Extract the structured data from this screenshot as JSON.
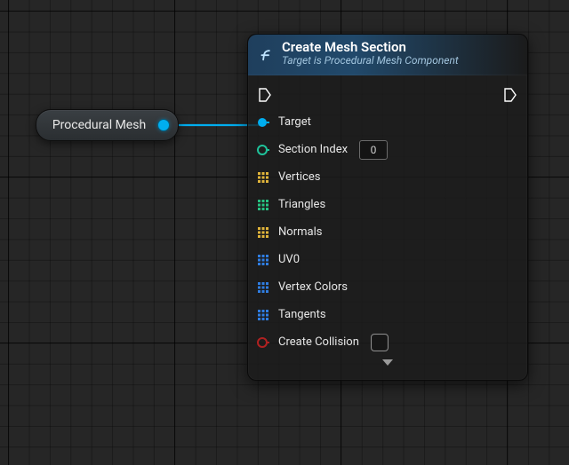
{
  "colors": {
    "object_pin": "#00aef0",
    "int_pin": "#1fc29a",
    "array_pin_yellow": "#e0b43a",
    "array_pin_green": "#26c281",
    "array_pin_blue": "#2f7de1",
    "bool_pin": "#b02121"
  },
  "variable_node": {
    "label": "Procedural Mesh"
  },
  "node": {
    "title": "Create Mesh Section",
    "subtitle": "Target is Procedural Mesh Component",
    "pins": {
      "target": "Target",
      "section_index": {
        "label": "Section Index",
        "value": "0"
      },
      "vertices": "Vertices",
      "triangles": "Triangles",
      "normals": "Normals",
      "uv0": "UV0",
      "vertex_colors": "Vertex Colors",
      "tangents": "Tangents",
      "create_collision": "Create Collision"
    }
  }
}
